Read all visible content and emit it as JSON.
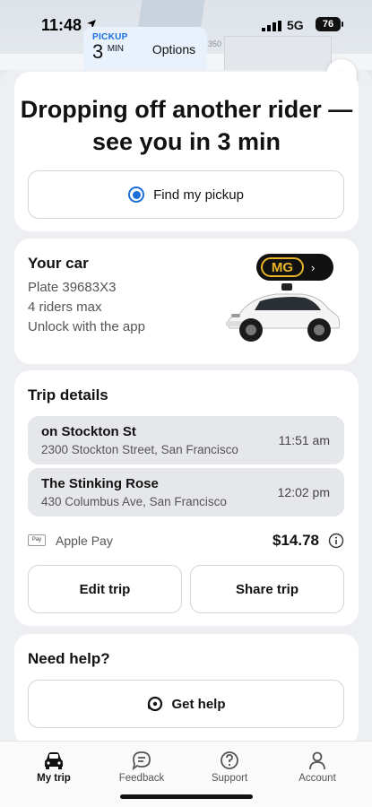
{
  "status_bar": {
    "time": "11:48",
    "network": "5G",
    "battery": "76"
  },
  "pickup_chip": {
    "label": "PICKUP",
    "minutes": "3",
    "unit": "MIN",
    "options_label": "Options"
  },
  "map": {
    "label_number": "350"
  },
  "main_card": {
    "headline": "Dropping off another rider — see you in 3 min",
    "find_pickup_label": "Find my pickup"
  },
  "car_card": {
    "title": "Your car",
    "plate": "Plate 39683X3",
    "riders": "4 riders max",
    "unlock": "Unlock with the app",
    "code": "MG"
  },
  "trip_card": {
    "title": "Trip details",
    "stops": [
      {
        "name": "on Stockton St",
        "address": "2300 Stockton Street, San Francisco",
        "time": "11:51 am"
      },
      {
        "name": "The Stinking Rose",
        "address": "430 Columbus Ave, San Francisco",
        "time": "12:02 pm"
      }
    ],
    "payment_method": "Apple Pay",
    "payment_icon_text": "Pay",
    "price": "$14.78",
    "edit_label": "Edit trip",
    "share_label": "Share trip"
  },
  "help_card": {
    "title": "Need help?",
    "button_label": "Get help"
  },
  "tabs": [
    {
      "label": "My trip",
      "icon": "car-icon",
      "active": true
    },
    {
      "label": "Feedback",
      "icon": "feedback-icon",
      "active": false
    },
    {
      "label": "Support",
      "icon": "support-icon",
      "active": false
    },
    {
      "label": "Account",
      "icon": "account-icon",
      "active": false
    }
  ],
  "colors": {
    "accent": "#1a6fd9",
    "code_yellow": "#e9b428",
    "card_bg": "#ffffff",
    "sheet_bg": "#eeeff3"
  }
}
